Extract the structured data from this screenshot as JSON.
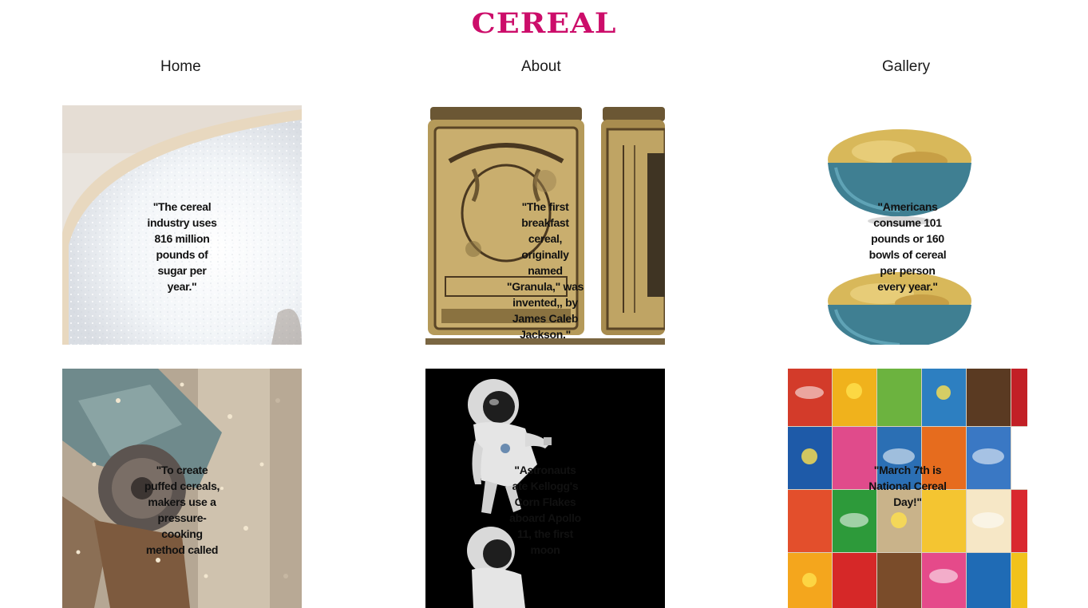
{
  "header": {
    "logo_text": "CEREAL"
  },
  "nav": {
    "home": "Home",
    "about": "About",
    "gallery": "Gallery"
  },
  "cards": [
    {
      "image": "sugar-photo",
      "quote": "\"The cereal industry uses 816 million pounds of sugar per year.\""
    },
    {
      "image": "granula-tin-photo",
      "quote": "\"The first breakfast cereal, originally named \"Granula,\" was invented,, by James Caleb Jackson.\""
    },
    {
      "image": "cereal-bowl-photo",
      "quote": "\"Americans consume 101 pounds or 160 bowls of cereal per person every year.\""
    },
    {
      "image": "puffing-machine-photo",
      "quote": "\"To create puffed cereals, makers use a pressure-cooking method called"
    },
    {
      "image": "astronaut-photo",
      "quote": "\"Astronauts ate Kellogg's Corn Flakes aboard Apollo 11, the first moon"
    },
    {
      "image": "cereal-boxes-photo",
      "quote": "\"March 7th is National Cereal Day!\""
    }
  ],
  "colors": {
    "brand": "#cc0d6a",
    "text": "#1a1a1a",
    "background": "#ffffff"
  }
}
